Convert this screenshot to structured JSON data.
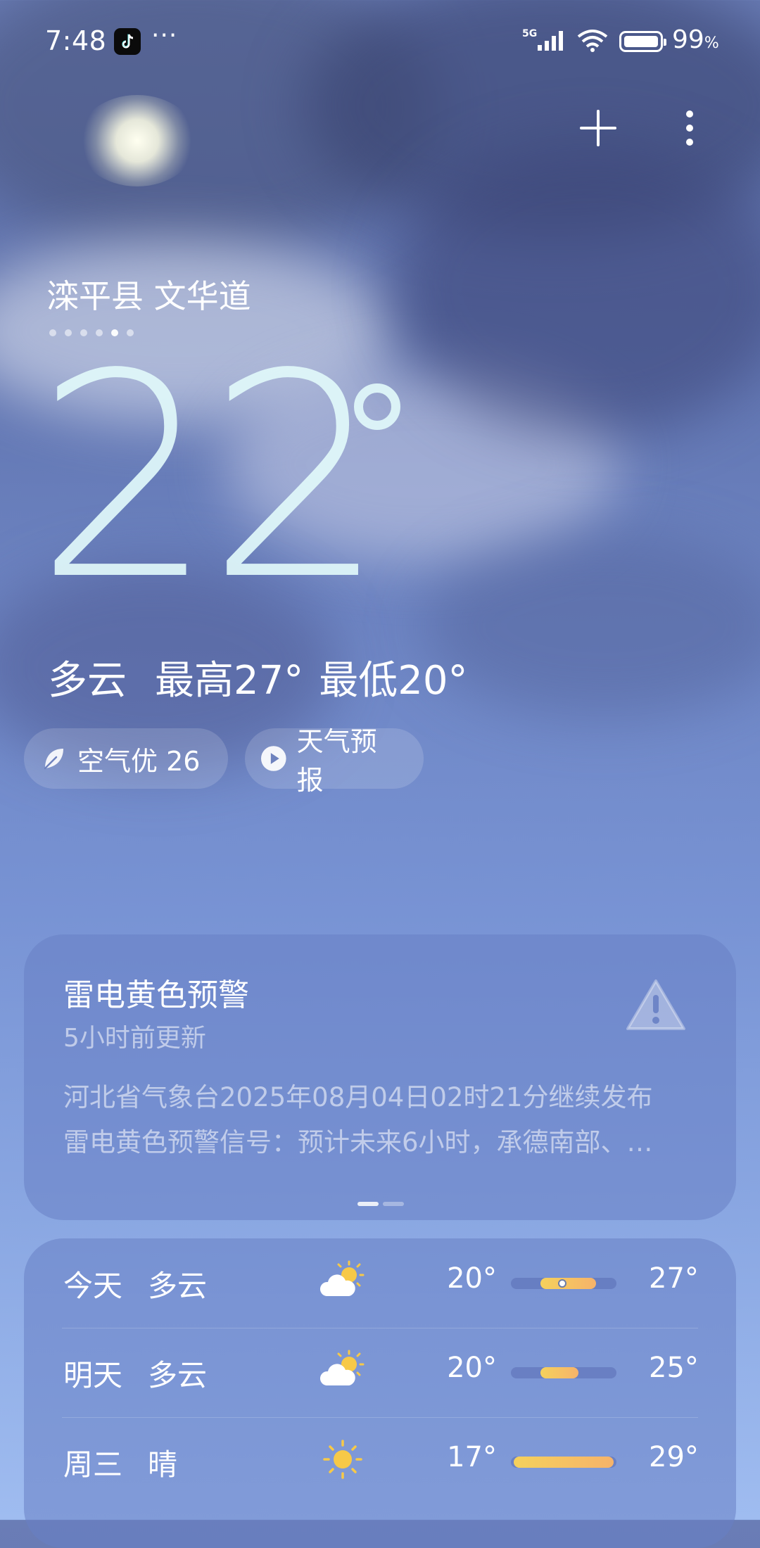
{
  "status_bar": {
    "time": "7:48",
    "more": "···",
    "network": "5G",
    "battery_value": "99",
    "battery_unit": "%"
  },
  "header": {
    "add_icon": "plus-icon",
    "menu_icon": "more-vertical-icon"
  },
  "location": {
    "name": "滦平县 文华道",
    "page_count": 6,
    "active_page": 5
  },
  "current": {
    "temperature": "22",
    "condition": "多云",
    "high": "最高27°",
    "low": "最低20°"
  },
  "pills": {
    "aqi_label": "空气优 26",
    "forecast_label": "天气预报"
  },
  "alert": {
    "title": "雷电黄色预警",
    "updated": "5小时前更新",
    "body_line1": "河北省气象台2025年08月04日02时21分继续发布",
    "body_line2": "雷电黄色预警信号：预计未来6小时，承德南部、…",
    "icon": "warning-triangle-icon",
    "accent_color": "#f2c94c"
  },
  "forecast": {
    "days": [
      {
        "day": "今天",
        "condition": "多云",
        "icon": "partly-cloudy-icon",
        "low": "20°",
        "high": "27°",
        "low_value": 20,
        "high_value": 27,
        "current_value": 22
      },
      {
        "day": "明天",
        "condition": "多云",
        "icon": "partly-cloudy-icon",
        "low": "20°",
        "high": "25°",
        "low_value": 20,
        "high_value": 25
      },
      {
        "day": "周三",
        "condition": "晴",
        "icon": "sun-icon",
        "low": "17°",
        "high": "29°",
        "low_value": 17,
        "high_value": 29
      }
    ],
    "range_min": 17,
    "range_max": 29
  }
}
